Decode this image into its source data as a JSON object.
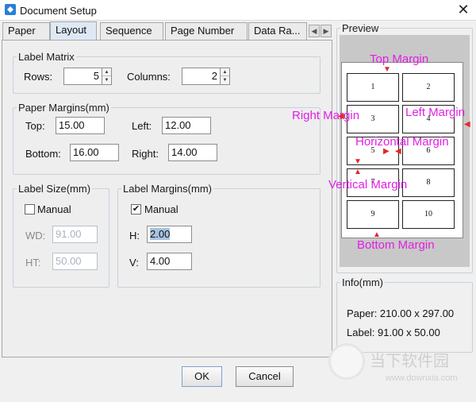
{
  "window": {
    "title": "Document Setup",
    "close_icon": "✕"
  },
  "tabs": [
    {
      "label": "Paper"
    },
    {
      "label": "Layout",
      "active": true
    },
    {
      "label": "Sequence"
    },
    {
      "label": "Page Number"
    },
    {
      "label": "Data Ra..."
    }
  ],
  "label_matrix": {
    "legend": "Label Matrix",
    "rows_label": "Rows:",
    "rows_value": "5",
    "columns_label": "Columns:",
    "columns_value": "2"
  },
  "paper_margins": {
    "legend": "Paper Margins(mm)",
    "top_label": "Top:",
    "top_value": "15.00",
    "left_label": "Left:",
    "left_value": "12.00",
    "bottom_label": "Bottom:",
    "bottom_value": "16.00",
    "right_label": "Right:",
    "right_value": "14.00"
  },
  "label_size": {
    "legend": "Label Size(mm)",
    "manual_label": "Manual",
    "manual_checked": false,
    "wd_label": "WD:",
    "wd_value": "91.00",
    "ht_label": "HT:",
    "ht_value": "50.00"
  },
  "label_margins": {
    "legend": "Label Margins(mm)",
    "manual_label": "Manual",
    "manual_checked": true,
    "check_mark": "✔",
    "h_label": "H:",
    "h_value": "2.00",
    "v_label": "V:",
    "v_value": "4.00"
  },
  "preview": {
    "legend": "Preview",
    "cells": [
      "1",
      "2",
      "3",
      "4",
      "5",
      "6",
      "7",
      "8",
      "9",
      "10"
    ],
    "annotations": {
      "top": "Top Margin",
      "right": "Right Margin",
      "left": "Left Margin",
      "horizontal": "Horizontal Margin",
      "vertical": "Vertical Margin",
      "bottom": "Bottom Margin"
    }
  },
  "info": {
    "legend": "Info(mm)",
    "paper_line": "Paper:  210.00 x 297.00",
    "label_line": "Label:  91.00 x 50.00"
  },
  "buttons": {
    "ok": "OK",
    "cancel": "Cancel"
  },
  "watermark": {
    "cn": "当下软件园",
    "url": "www.downxia.com"
  },
  "colors": {
    "annotation": "#e31ee6",
    "arrow": "#e22828",
    "active_tab": "#dfe9f5"
  }
}
